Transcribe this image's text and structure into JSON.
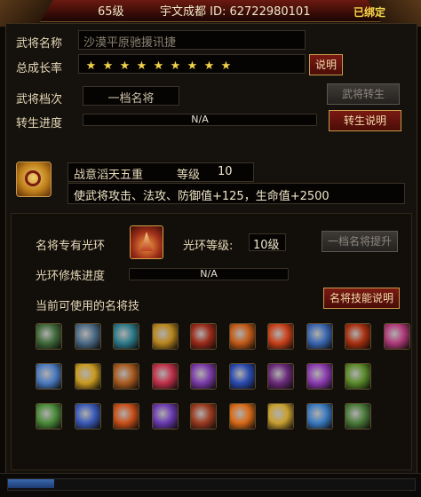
{
  "header": {
    "level": "65级",
    "name_id": "宇文成都 ID: 62722980101",
    "bound": "已绑定"
  },
  "general": {
    "name_label": "武将名称",
    "name_placeholder": "沙漠平原驰援讯捷",
    "growth_label": "总成长率",
    "stars": [
      "★",
      "★",
      "★",
      "★",
      "★",
      "★",
      "★",
      "★",
      "★"
    ],
    "explain_button": "说明",
    "grade_label": "武将档次",
    "grade_value": "一档名将",
    "rebirth_button": "武将转生",
    "rebirth_progress_label": "转生进度",
    "rebirth_progress_text": "N/A",
    "rebirth_progress_fraction": 0,
    "rebirth_explain_button": "转生说明"
  },
  "skill_main": {
    "name": "战意滔天五重",
    "level_label": "等级",
    "level_value": "10",
    "description": "使武将攻击、法攻、防御值+125，生命值+2500"
  },
  "aura": {
    "label": "名将专有光环",
    "level_label": "光环等级:",
    "level_value": "10级",
    "upgrade_button": "一档名将提升",
    "progress_label": "光环修炼进度",
    "progress_text": "N/A",
    "progress_fraction": 0,
    "skills_label": "当前可使用的名将技",
    "skills_explain_button": "名将技能说明"
  },
  "skill_icons": [
    {
      "icon": "spin-axe-icon",
      "color": "#3f6a3a"
    },
    {
      "icon": "hammer-icon",
      "color": "#4b6a86"
    },
    {
      "icon": "whirl-icon",
      "color": "#2d7a8a"
    },
    {
      "icon": "golden-blade-icon",
      "color": "#b8861e"
    },
    {
      "icon": "red-slash-icon",
      "color": "#9a2a1a"
    },
    {
      "icon": "fire-wave-icon",
      "color": "#c25a18"
    },
    {
      "icon": "fire-sword-icon",
      "color": "#c8401a"
    },
    {
      "icon": "ice-spear-icon",
      "color": "#3a66b0"
    },
    {
      "icon": "flame-warrior-icon",
      "color": "#a83010"
    },
    {
      "icon": "pink-wings-icon",
      "color": "#b03a7a"
    },
    {
      "icon": "blue-wings-icon",
      "color": "#4a7ac0"
    },
    {
      "icon": "golden-shield-icon",
      "color": "#c89a20"
    },
    {
      "icon": "dragon-icon",
      "color": "#a85a20"
    },
    {
      "icon": "hearts-icon",
      "color": "#c0304a"
    },
    {
      "icon": "purple-orb-icon",
      "color": "#7a3aa8"
    },
    {
      "icon": "blue-swirl-icon",
      "color": "#2a4ab0"
    },
    {
      "icon": "purple-demon-icon",
      "color": "#6a2a7a"
    },
    {
      "icon": "violet-spiral-icon",
      "color": "#8a3ab0"
    },
    {
      "icon": "green-spirit-icon",
      "color": "#5a8a2a"
    },
    {
      "icon": "green-figure-icon",
      "color": "#4a8a3a"
    },
    {
      "icon": "blue-ghost-icon",
      "color": "#3a5ab8"
    },
    {
      "icon": "fire-pillars-icon",
      "color": "#c8501a"
    },
    {
      "icon": "violet-mage-icon",
      "color": "#6a3ab0"
    },
    {
      "icon": "red-totem-icon",
      "color": "#9a3a20"
    },
    {
      "icon": "blaze-icon",
      "color": "#d86a18"
    },
    {
      "icon": "golden-burst-icon",
      "color": "#c8a030"
    },
    {
      "icon": "ice-figure-icon",
      "color": "#3a7ac0"
    },
    {
      "icon": "green-golem-icon",
      "color": "#4a7a3a"
    }
  ],
  "colors": {
    "header_bg": "#5a140c",
    "accent_gold": "#f3d34a",
    "button_red": "#7a1a12"
  }
}
